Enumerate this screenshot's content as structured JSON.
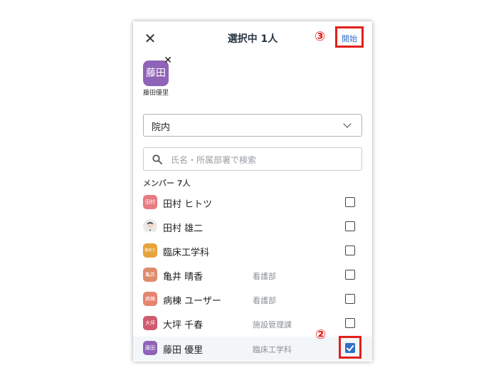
{
  "header": {
    "close_icon": "close-icon",
    "title": "選択中 1人",
    "start_label": "開始"
  },
  "annotations": {
    "step3": "③",
    "step2": "②"
  },
  "selected_chips": [
    {
      "avatar_text": "藤田",
      "name": "藤田優里",
      "color": "#8f63b7"
    }
  ],
  "scope_select": {
    "value": "院内"
  },
  "search": {
    "placeholder": "氏名・所属部署で検索"
  },
  "members_header": "メンバー 7人",
  "members": [
    {
      "name": "田村 ヒトツ",
      "dept": "",
      "avatar_text": "田村",
      "color": "#e77b82",
      "checked": false
    },
    {
      "name": "田村 雄二",
      "dept": "",
      "avatar_text": "",
      "color": "#e9e9e9",
      "checked": false,
      "photo": true
    },
    {
      "name": "臨床工学科",
      "dept": "",
      "avatar_text": "臨床工",
      "color": "#e8a33d",
      "checked": false
    },
    {
      "name": "亀井 晴香",
      "dept": "看護部",
      "avatar_text": "亀井",
      "color": "#df8c6c",
      "checked": false
    },
    {
      "name": "病棟 ユーザー",
      "dept": "看護部",
      "avatar_text": "病棟",
      "color": "#e5846f",
      "checked": false
    },
    {
      "name": "大坪 千春",
      "dept": "施設管理課",
      "avatar_text": "大坪",
      "color": "#cf5b6e",
      "checked": false
    },
    {
      "name": "藤田 優里",
      "dept": "臨床工学科",
      "avatar_text": "藤田",
      "color": "#8f63b7",
      "checked": true
    }
  ]
}
